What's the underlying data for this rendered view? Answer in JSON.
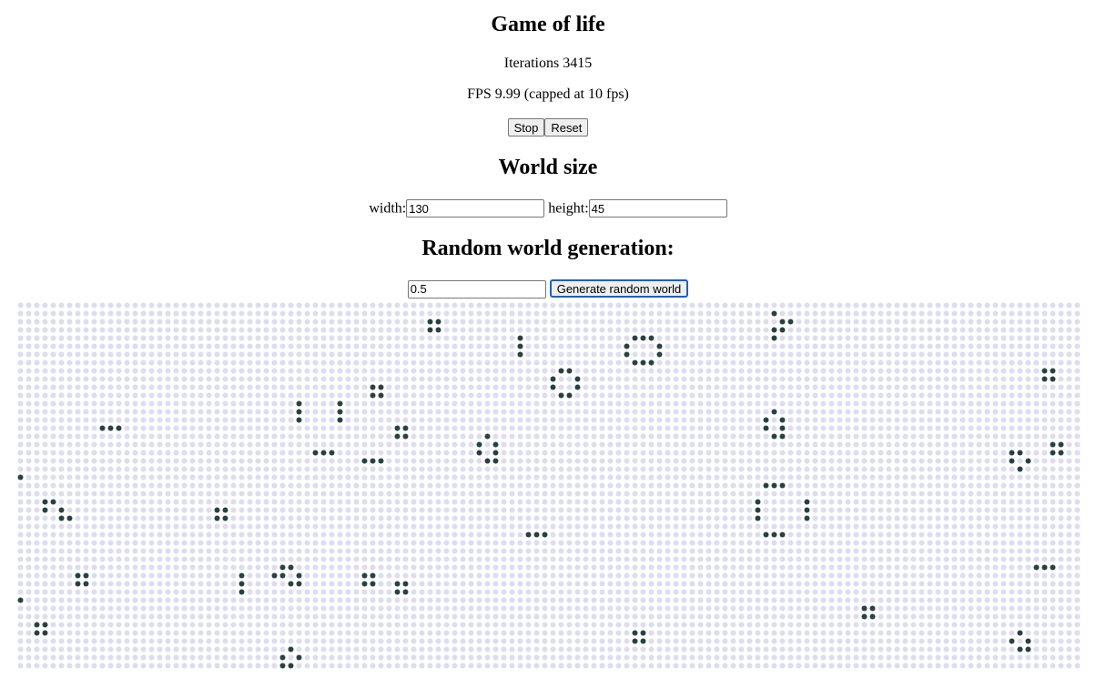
{
  "title": "Game of life",
  "iterations_label": "Iterations",
  "iterations": "3415",
  "fps_text": "FPS 9.99 (capped at 10 fps)",
  "buttons": {
    "stop": "Stop",
    "reset": "Reset",
    "generate": "Generate random world"
  },
  "world_size": {
    "heading": "World size",
    "width_label": "width:",
    "width_value": "130",
    "height_label": "height:",
    "height_value": "45"
  },
  "random": {
    "heading": "Random world generation:",
    "probability": "0.5"
  },
  "grid": {
    "cols": 130,
    "rows": 45,
    "alive_color": "#2b4040",
    "dead_color": "#dcdcf2",
    "alive_cells": [
      [
        1,
        92
      ],
      [
        2,
        50
      ],
      [
        2,
        51
      ],
      [
        2,
        93
      ],
      [
        2,
        94
      ],
      [
        3,
        50
      ],
      [
        3,
        51
      ],
      [
        3,
        92
      ],
      [
        3,
        93
      ],
      [
        4,
        61
      ],
      [
        4,
        75
      ],
      [
        4,
        76
      ],
      [
        4,
        77
      ],
      [
        4,
        92
      ],
      [
        5,
        61
      ],
      [
        5,
        74
      ],
      [
        5,
        78
      ],
      [
        6,
        61
      ],
      [
        6,
        74
      ],
      [
        6,
        78
      ],
      [
        7,
        75
      ],
      [
        7,
        76
      ],
      [
        7,
        77
      ],
      [
        8,
        66
      ],
      [
        8,
        67
      ],
      [
        8,
        125
      ],
      [
        8,
        126
      ],
      [
        9,
        65
      ],
      [
        9,
        68
      ],
      [
        9,
        125
      ],
      [
        9,
        126
      ],
      [
        10,
        43
      ],
      [
        10,
        44
      ],
      [
        10,
        65
      ],
      [
        10,
        68
      ],
      [
        11,
        43
      ],
      [
        11,
        44
      ],
      [
        11,
        66
      ],
      [
        11,
        67
      ],
      [
        12,
        34
      ],
      [
        12,
        39
      ],
      [
        13,
        34
      ],
      [
        13,
        39
      ],
      [
        13,
        92
      ],
      [
        14,
        34
      ],
      [
        14,
        39
      ],
      [
        14,
        91
      ],
      [
        14,
        93
      ],
      [
        15,
        10
      ],
      [
        15,
        11
      ],
      [
        15,
        12
      ],
      [
        15,
        46
      ],
      [
        15,
        47
      ],
      [
        15,
        91
      ],
      [
        15,
        93
      ],
      [
        16,
        46
      ],
      [
        16,
        47
      ],
      [
        16,
        57
      ],
      [
        16,
        92
      ],
      [
        16,
        93
      ],
      [
        17,
        56
      ],
      [
        17,
        58
      ],
      [
        17,
        126
      ],
      [
        17,
        127
      ],
      [
        18,
        36
      ],
      [
        18,
        37
      ],
      [
        18,
        38
      ],
      [
        18,
        56
      ],
      [
        18,
        58
      ],
      [
        18,
        121
      ],
      [
        18,
        122
      ],
      [
        18,
        126
      ],
      [
        18,
        127
      ],
      [
        19,
        42
      ],
      [
        19,
        43
      ],
      [
        19,
        44
      ],
      [
        19,
        57
      ],
      [
        19,
        58
      ],
      [
        19,
        121
      ],
      [
        19,
        123
      ],
      [
        20,
        122
      ],
      [
        21,
        0
      ],
      [
        22,
        91
      ],
      [
        22,
        92
      ],
      [
        22,
        93
      ],
      [
        24,
        3
      ],
      [
        24,
        4
      ],
      [
        24,
        90
      ],
      [
        24,
        96
      ],
      [
        25,
        3
      ],
      [
        25,
        5
      ],
      [
        25,
        24
      ],
      [
        25,
        25
      ],
      [
        25,
        90
      ],
      [
        25,
        96
      ],
      [
        26,
        5
      ],
      [
        26,
        6
      ],
      [
        26,
        24
      ],
      [
        26,
        25
      ],
      [
        26,
        90
      ],
      [
        26,
        96
      ],
      [
        28,
        62
      ],
      [
        28,
        63
      ],
      [
        28,
        64
      ],
      [
        28,
        91
      ],
      [
        28,
        92
      ],
      [
        28,
        93
      ],
      [
        32,
        32
      ],
      [
        32,
        33
      ],
      [
        32,
        124
      ],
      [
        32,
        125
      ],
      [
        32,
        126
      ],
      [
        33,
        7
      ],
      [
        33,
        8
      ],
      [
        33,
        27
      ],
      [
        33,
        31
      ],
      [
        33,
        32
      ],
      [
        33,
        34
      ],
      [
        33,
        42
      ],
      [
        33,
        43
      ],
      [
        34,
        7
      ],
      [
        34,
        8
      ],
      [
        34,
        27
      ],
      [
        34,
        33
      ],
      [
        34,
        34
      ],
      [
        34,
        42
      ],
      [
        34,
        43
      ],
      [
        34,
        46
      ],
      [
        34,
        47
      ],
      [
        35,
        27
      ],
      [
        35,
        46
      ],
      [
        35,
        47
      ],
      [
        36,
        0
      ],
      [
        37,
        103
      ],
      [
        37,
        104
      ],
      [
        38,
        103
      ],
      [
        38,
        104
      ],
      [
        39,
        2
      ],
      [
        39,
        3
      ],
      [
        40,
        2
      ],
      [
        40,
        3
      ],
      [
        40,
        75
      ],
      [
        40,
        76
      ],
      [
        40,
        122
      ],
      [
        41,
        75
      ],
      [
        41,
        76
      ],
      [
        41,
        121
      ],
      [
        41,
        123
      ],
      [
        42,
        33
      ],
      [
        42,
        122
      ],
      [
        42,
        123
      ],
      [
        43,
        32
      ],
      [
        43,
        34
      ],
      [
        44,
        32
      ],
      [
        44,
        33
      ]
    ]
  }
}
